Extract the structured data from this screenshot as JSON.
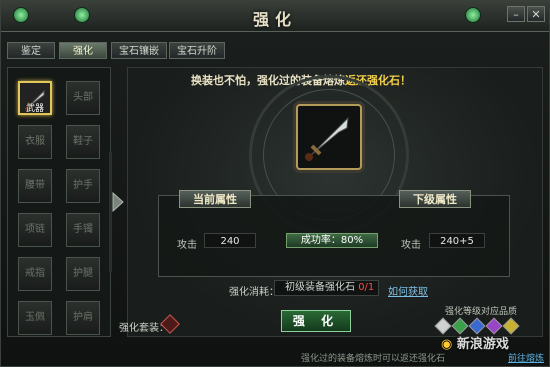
{
  "window": {
    "title": "强化"
  },
  "tabs": [
    {
      "label": "鉴定"
    },
    {
      "label": "强化"
    },
    {
      "label": "宝石镶嵌"
    },
    {
      "label": "宝石升阶"
    }
  ],
  "slots": [
    {
      "label": "武器",
      "selected": true
    },
    {
      "label": "头部"
    },
    {
      "label": "衣服"
    },
    {
      "label": "鞋子"
    },
    {
      "label": "腰带"
    },
    {
      "label": "护手"
    },
    {
      "label": "项链"
    },
    {
      "label": "手镯"
    },
    {
      "label": "戒指"
    },
    {
      "label": "护腿"
    },
    {
      "label": "玉佩"
    },
    {
      "label": "护肩"
    }
  ],
  "banner": {
    "text": "换装也不怕，强化过的装备熔炼",
    "highlight": "返还强化石！"
  },
  "stats": {
    "current_header": "当前属性",
    "next_header": "下级属性",
    "attr_label": "攻击",
    "current_value": "240",
    "next_value": "240+5",
    "success_rate": "成功率：80%"
  },
  "cost": {
    "label": "强化消耗：",
    "item": "初级装备强化石",
    "count": "0/1",
    "get_link": "如何获取"
  },
  "enhance_button": "强 化",
  "set_label": "强化套装：",
  "grade_label": "强化等级对应品质",
  "footer": {
    "note": "强化过的装备熔炼时可以返还强化石",
    "link": "前往熔炼"
  },
  "watermark": "新浪游戏",
  "colors": {
    "highlight": "#f5d24a",
    "rate_bar": "#3e6a43",
    "count_red": "#ff4a40"
  }
}
